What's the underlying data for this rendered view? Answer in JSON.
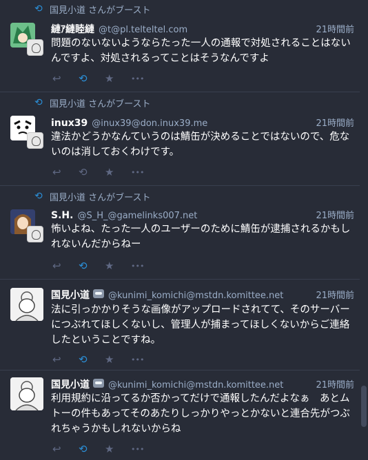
{
  "posts": [
    {
      "boost": "国見小道 さんがブースト",
      "name": "縺ｱ縺睦縺",
      "acct": "@t@pl.telteltel.com",
      "time": "21時間前",
      "content": "問題のないないようならたった一人の通報で対処されることはないんですよ、対処されるってことはそうなんですよ",
      "boosted": true
    },
    {
      "boost": "国見小道 さんがブースト",
      "name": "inux39",
      "acct": "@inux39@don.inux39.me",
      "time": "21時間前",
      "content": "違法かどうかなんていうのは鯖缶が決めることではないので、危ないのは消しておくわけです。",
      "boosted": false
    },
    {
      "boost": "国見小道 さんがブースト",
      "name": "S.H.",
      "acct": "@S_H_@gamelinks007.net",
      "time": "21時間前",
      "content": "怖いよね、たった一人のユーザーのために鯖缶が逮捕されるかもしれないんだからねー",
      "boosted": true
    },
    {
      "name": "国見小道",
      "acct": "@kunimi_komichi@mstdn.komittee.net",
      "time": "21時間前",
      "content": "法に引っかかりそうな画像がアップロードされてて、そのサーバーにつぶれてほしくないし、管理人が捕まってほしくないからご連絡したということですね。",
      "boosted": true
    },
    {
      "name": "国見小道",
      "acct": "@kunimi_komichi@mstdn.komittee.net",
      "time": "21時間前",
      "content": "利用規約に沿ってるか否かってだけで通報したんだよなぁ　あとムトーの件もあってそのあたりしっかりやっとかないと連合先がつぶれちゃうかもしれないからね",
      "boosted": true
    }
  ],
  "icons": {
    "reply": "↩",
    "boost": "⟲",
    "favourite": "★",
    "more": "•••"
  },
  "colors": {
    "background": "#282c37",
    "accent": "#2b90d9",
    "muted": "#9baec8",
    "action": "#606984"
  }
}
